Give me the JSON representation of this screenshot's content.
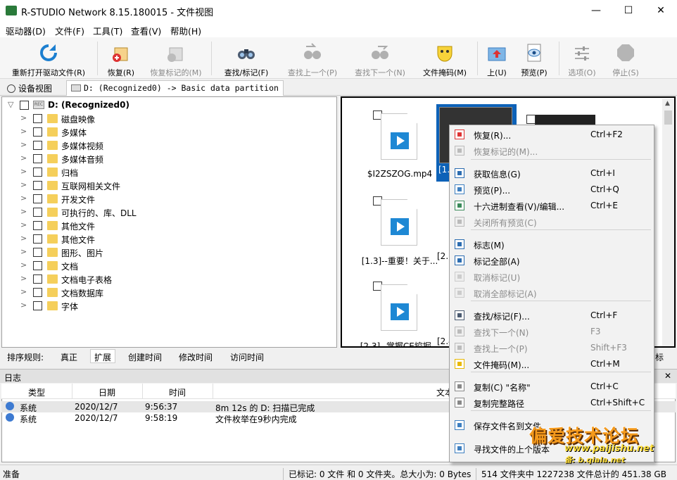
{
  "window": {
    "title": "R-STUDIO Network 8.15.180015 - 文件视图",
    "min": "—",
    "max": "☐",
    "close": "✕"
  },
  "menu": [
    "驱动器(D)",
    "文件(F)",
    "工具(T)",
    "查看(V)",
    "帮助(H)"
  ],
  "toolbar": [
    {
      "label": "重新打开驱动文件(R)",
      "icon": "refresh-icon",
      "enabled": true
    },
    {
      "label": "恢复(R)",
      "icon": "recover-icon",
      "enabled": true
    },
    {
      "label": "恢复标记的(M)",
      "icon": "recover-marked-icon",
      "enabled": false
    },
    {
      "label": "查找/标记(F)",
      "icon": "binoculars-icon",
      "enabled": true
    },
    {
      "label": "查找上一个(P)",
      "icon": "find-prev-icon",
      "enabled": false
    },
    {
      "label": "查找下一个(N)",
      "icon": "find-next-icon",
      "enabled": false
    },
    {
      "label": "文件掩码(M)",
      "icon": "mask-icon",
      "enabled": true
    },
    {
      "label": "上(U)",
      "icon": "folder-up-icon",
      "enabled": true
    },
    {
      "label": "预览(P)",
      "icon": "preview-icon",
      "enabled": true
    },
    {
      "label": "选项(O)",
      "icon": "options-icon",
      "enabled": false
    },
    {
      "label": "停止(S)",
      "icon": "stop-icon",
      "enabled": false
    }
  ],
  "tabs": [
    {
      "label": "设备视图",
      "active": false
    },
    {
      "label": "D: (Recognized0) -> Basic data partition",
      "active": true
    }
  ],
  "tree": {
    "root": "D: (Recognized0)",
    "root_drive_tag": "REC",
    "folders": [
      "磁盘映像",
      "多媒体",
      "多媒体视频",
      "多媒体音频",
      "归档",
      "互联网相关文件",
      "开发文件",
      "可执行的、库、DLL",
      "其他文件",
      "其他文件",
      "图形、图片",
      "文档",
      "文档电子表格",
      "文档数据库",
      "字体"
    ]
  },
  "files": [
    {
      "name": "$I2ZSZOG.mp4"
    },
    {
      "name": "[1.3]--重要！关于..."
    },
    {
      "name": "[2.3]--掌握CE挖掘..."
    }
  ],
  "partial_labels": [
    "[1.",
    "[2.",
    "[2.4"
  ],
  "sortbar": {
    "label": "排序规则:",
    "items": [
      "真正",
      "扩展",
      "创建时间",
      "修改时间",
      "访问时间"
    ],
    "selected": "扩展",
    "right_fragment": "标"
  },
  "log": {
    "title": "日志",
    "close": "✕",
    "columns": [
      "类型",
      "日期",
      "时间",
      "文本"
    ],
    "rows": [
      {
        "type": "系统",
        "date": "2020/12/7",
        "time": "9:56:37",
        "text": "8m 12s 的 D: 扫描已完成"
      },
      {
        "type": "系统",
        "date": "2020/12/7",
        "time": "9:58:19",
        "text": "文件枚举在9秒内完成"
      }
    ]
  },
  "status": {
    "left": "准备",
    "marked": "已标记: 0 文件 和 0 文件夹。总大小为: 0 Bytes",
    "total": "514 文件夹中 1227238 文件总计的 451.38 GB"
  },
  "context_menu": [
    {
      "label": "恢复(R)...",
      "shortcut": "Ctrl+F2",
      "enabled": true,
      "icon": "recover-icon"
    },
    {
      "label": "恢复标记的(M)...",
      "shortcut": "",
      "enabled": false,
      "icon": "recover-marked-icon"
    },
    {
      "sep": true
    },
    {
      "label": "获取信息(G)",
      "shortcut": "Ctrl+I",
      "enabled": true,
      "icon": "info-icon"
    },
    {
      "label": "预览(P)...",
      "shortcut": "Ctrl+Q",
      "enabled": true,
      "icon": "preview-icon"
    },
    {
      "label": "十六进制查看(V)/编辑...",
      "shortcut": "Ctrl+E",
      "enabled": true,
      "icon": "hex-icon"
    },
    {
      "label": "关闭所有预览(C)",
      "shortcut": "",
      "enabled": false,
      "icon": "close-previews-icon"
    },
    {
      "sep": true
    },
    {
      "label": "标志(M)",
      "shortcut": "",
      "enabled": true,
      "icon": "checkbox-icon"
    },
    {
      "label": "标记全部(A)",
      "shortcut": "",
      "enabled": true,
      "icon": "check-all-icon"
    },
    {
      "label": "取消标记(U)",
      "shortcut": "",
      "enabled": false,
      "icon": "uncheck-icon"
    },
    {
      "label": "取消全部标记(A)",
      "shortcut": "",
      "enabled": false,
      "icon": "uncheck-all-icon"
    },
    {
      "sep": true
    },
    {
      "label": "查找/标记(F)...",
      "shortcut": "Ctrl+F",
      "enabled": true,
      "icon": "binoculars-icon"
    },
    {
      "label": "查找下一个(N)",
      "shortcut": "F3",
      "enabled": false,
      "icon": "find-next-icon"
    },
    {
      "label": "查找上一个(P)",
      "shortcut": "Shift+F3",
      "enabled": false,
      "icon": "find-prev-icon"
    },
    {
      "label": "文件掩码(M)...",
      "shortcut": "Ctrl+M",
      "enabled": true,
      "icon": "mask-icon"
    },
    {
      "sep": true
    },
    {
      "label": "复制(C) \"名称\"",
      "shortcut": "Ctrl+C",
      "enabled": true,
      "icon": "copy-icon"
    },
    {
      "label": "复制完整路径",
      "shortcut": "Ctrl+Shift+C",
      "enabled": true,
      "icon": "copy-path-icon"
    },
    {
      "sep": true
    },
    {
      "label": "保存文件名到文件",
      "shortcut": "",
      "enabled": true,
      "icon": "save-names-icon"
    },
    {
      "label": "寻找文件的上个版本",
      "shortcut": "",
      "enabled": true,
      "icon": "versions-icon"
    }
  ],
  "watermark": {
    "main": "偏爱技术论坛",
    "url": "www.paijishu.net",
    "sub": "备: b.qiala.net"
  },
  "colors": {
    "selection": "#0d62b8",
    "folder": "#f5cf5b",
    "video": "#1e88d4",
    "watermark": "#f59a1c"
  }
}
